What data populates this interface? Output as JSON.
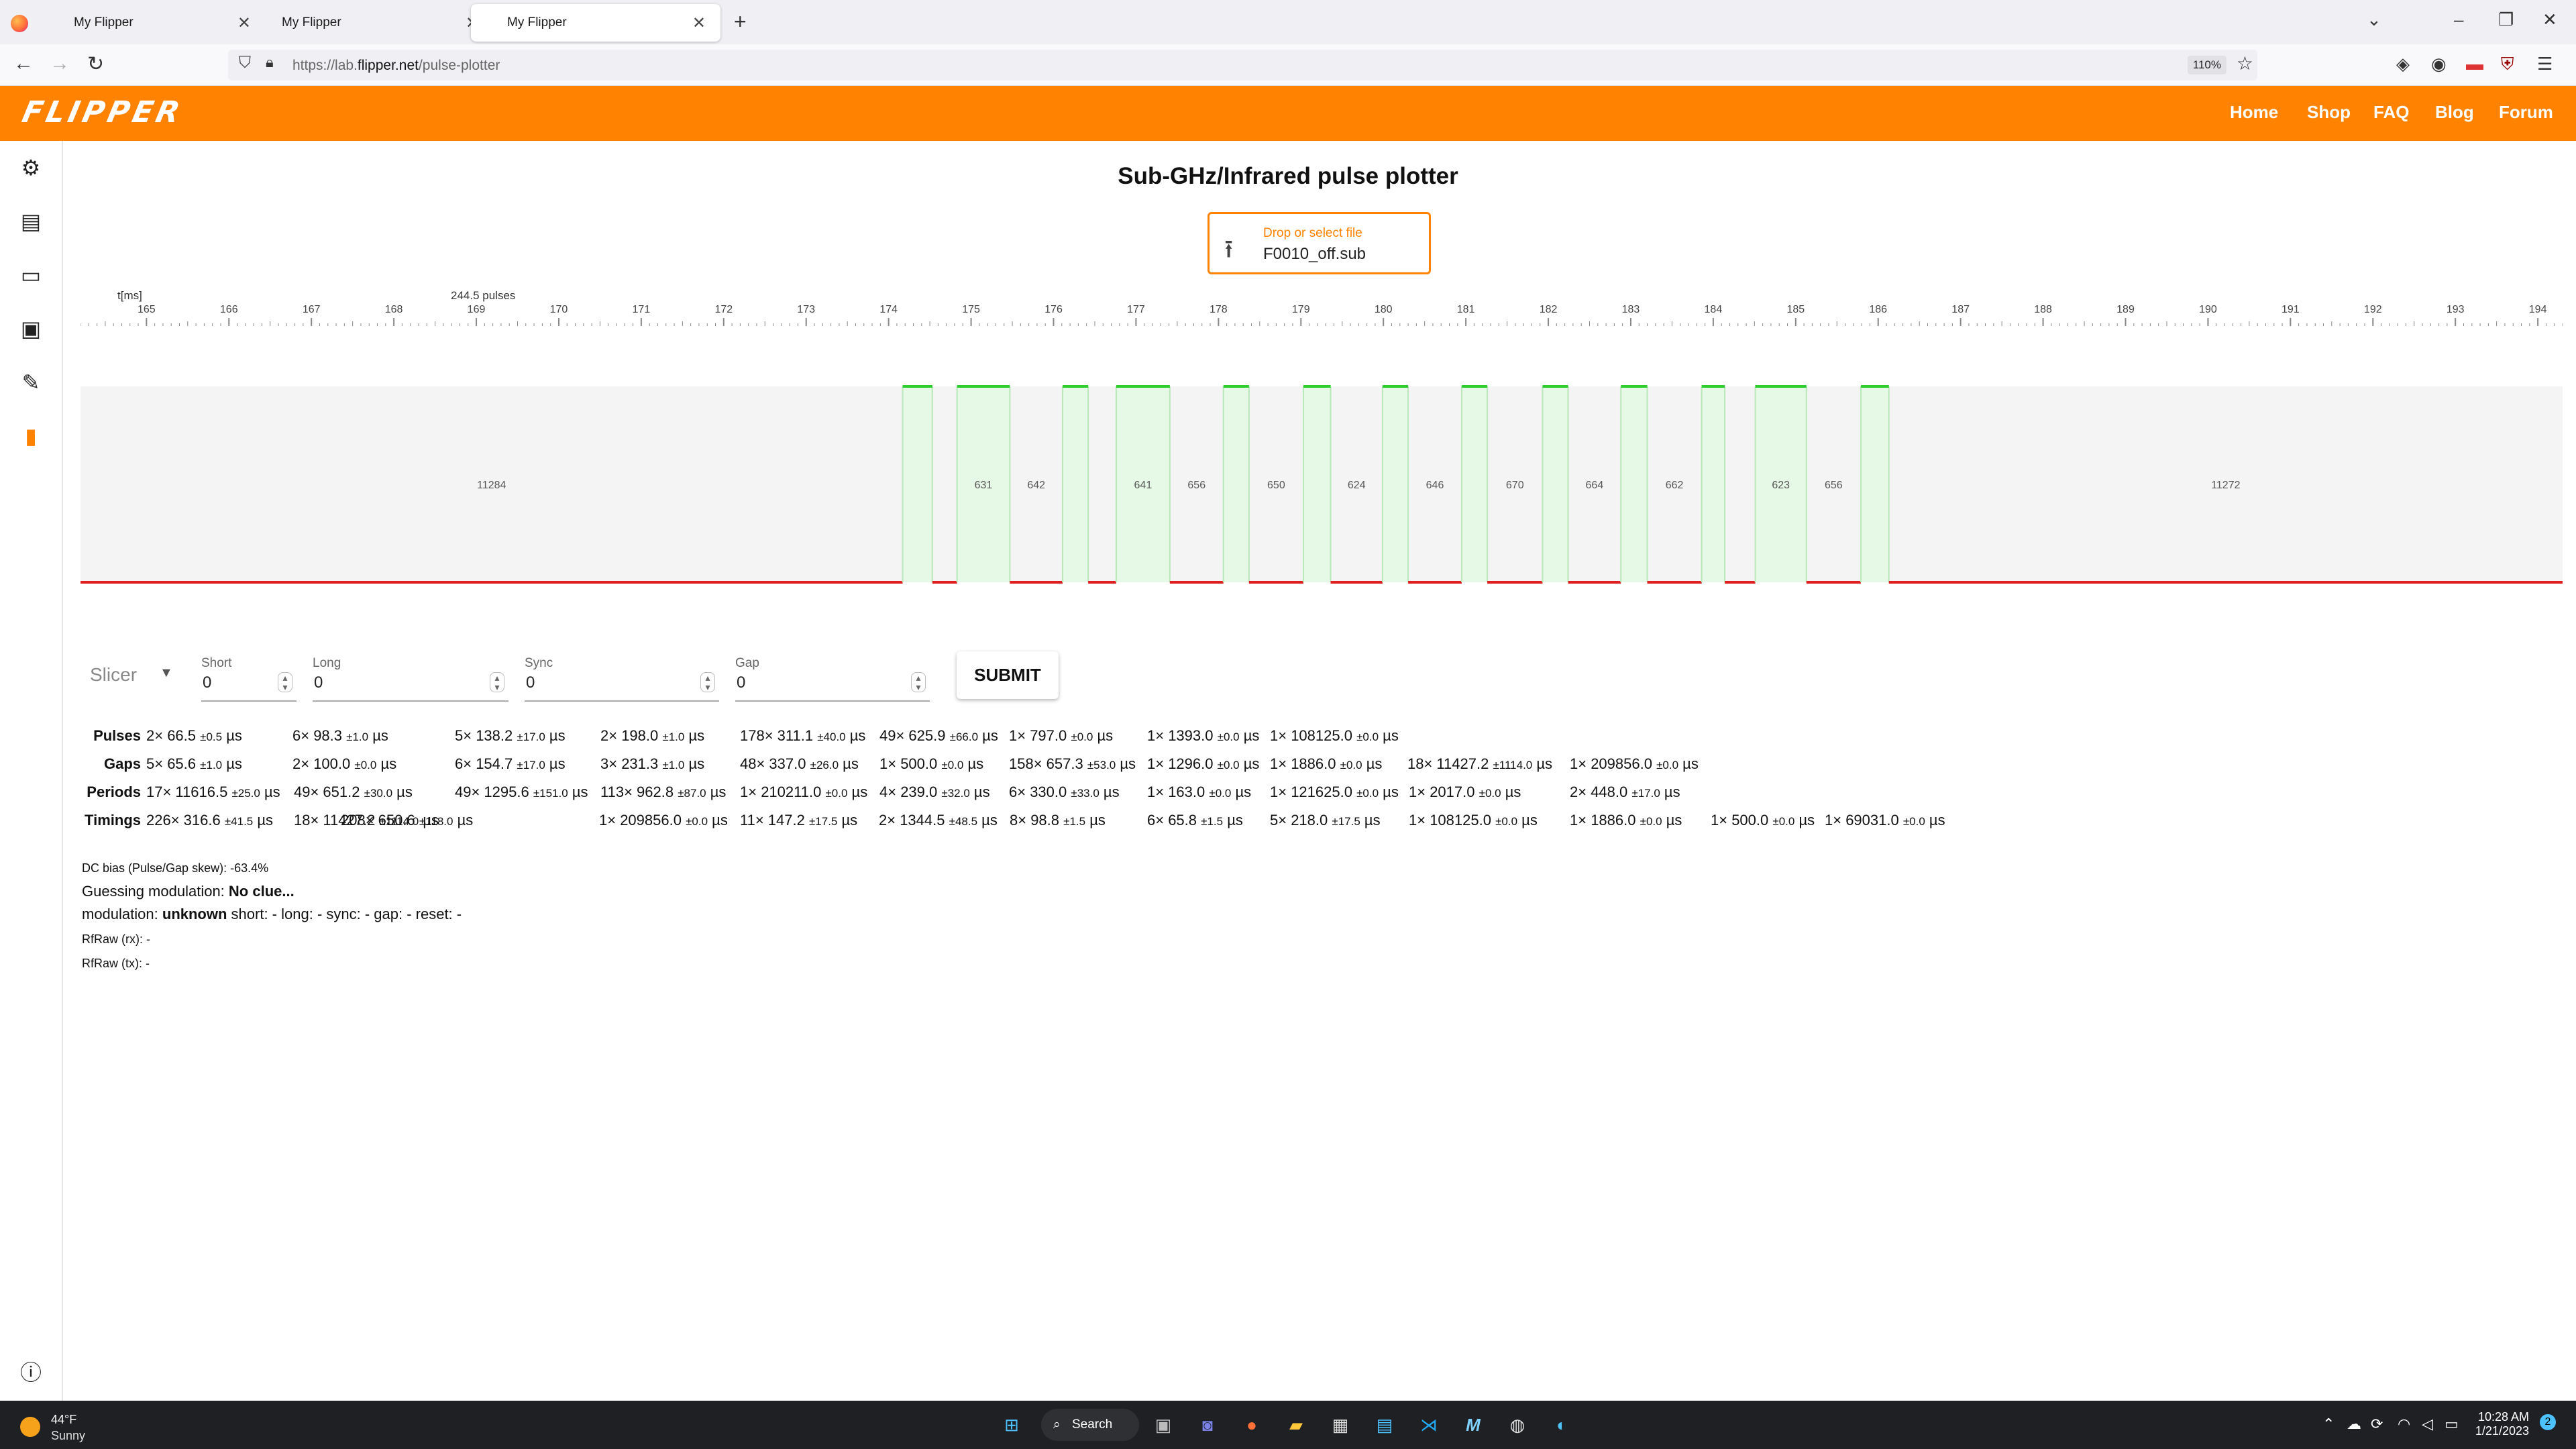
{
  "browser": {
    "tabs": [
      {
        "title": "My Flipper"
      },
      {
        "title": "My Flipper"
      },
      {
        "title": "My Flipper",
        "active": true
      }
    ],
    "url_prefix": "https://lab.",
    "url_domain": "flipper.net",
    "url_path": "/pulse-plotter",
    "zoom": "110%"
  },
  "app": {
    "logo": "FLIPPER",
    "nav": [
      "Home",
      "Shop",
      "FAQ",
      "Blog",
      "Forum"
    ],
    "brand_color": "#ff8200",
    "sidebar_icons": [
      "chip-icon",
      "archive-icon",
      "terminal-icon",
      "device-icon",
      "paint-icon",
      "bar-chart-icon"
    ]
  },
  "page": {
    "title": "Sub-GHz/Infrared pulse plotter",
    "upload_hint": "Drop or select file",
    "file_name": "F0010_off.sub"
  },
  "chart_data": {
    "type": "pulse-timeline",
    "axis_label": "t[ms]",
    "pulse_count_label": "244.5 pulses",
    "x_ticks": [
      165,
      166,
      167,
      168,
      169,
      170,
      171,
      172,
      173,
      174,
      175,
      176,
      177,
      178,
      179,
      180,
      181,
      182,
      183,
      184,
      185,
      186,
      187,
      188,
      189,
      190,
      191,
      192,
      193,
      194
    ],
    "x_range": [
      164.2,
      194.3
    ],
    "segments": [
      {
        "level": 0,
        "start": 164.2,
        "end": 174.17,
        "label": "11284"
      },
      {
        "level": 1,
        "start": 174.17,
        "end": 174.53,
        "label": ""
      },
      {
        "level": 0,
        "start": 174.53,
        "end": 174.83,
        "label": ""
      },
      {
        "level": 1,
        "start": 174.83,
        "end": 175.47,
        "label": "631"
      },
      {
        "level": 0,
        "start": 175.47,
        "end": 176.11,
        "label": "642"
      },
      {
        "level": 1,
        "start": 176.11,
        "end": 176.42,
        "label": ""
      },
      {
        "level": 0,
        "start": 176.42,
        "end": 176.76,
        "label": ""
      },
      {
        "level": 1,
        "start": 176.76,
        "end": 177.41,
        "label": "641"
      },
      {
        "level": 0,
        "start": 177.41,
        "end": 178.06,
        "label": "656"
      },
      {
        "level": 1,
        "start": 178.06,
        "end": 178.37,
        "label": ""
      },
      {
        "level": 0,
        "start": 178.37,
        "end": 179.03,
        "label": "650"
      },
      {
        "level": 1,
        "start": 179.03,
        "end": 179.36,
        "label": ""
      },
      {
        "level": 0,
        "start": 179.36,
        "end": 179.99,
        "label": "624"
      },
      {
        "level": 1,
        "start": 179.99,
        "end": 180.3,
        "label": ""
      },
      {
        "level": 0,
        "start": 180.3,
        "end": 180.95,
        "label": "646"
      },
      {
        "level": 1,
        "start": 180.95,
        "end": 181.26,
        "label": ""
      },
      {
        "level": 0,
        "start": 181.26,
        "end": 181.93,
        "label": "670"
      },
      {
        "level": 1,
        "start": 181.93,
        "end": 182.24,
        "label": ""
      },
      {
        "level": 0,
        "start": 182.24,
        "end": 182.88,
        "label": "664"
      },
      {
        "level": 1,
        "start": 182.88,
        "end": 183.2,
        "label": ""
      },
      {
        "level": 0,
        "start": 183.2,
        "end": 183.86,
        "label": "662"
      },
      {
        "level": 1,
        "start": 183.86,
        "end": 184.14,
        "label": ""
      },
      {
        "level": 0,
        "start": 184.14,
        "end": 184.51,
        "label": ""
      },
      {
        "level": 1,
        "start": 184.51,
        "end": 185.13,
        "label": "623"
      },
      {
        "level": 0,
        "start": 185.13,
        "end": 185.79,
        "label": "656"
      },
      {
        "level": 1,
        "start": 185.79,
        "end": 186.13,
        "label": ""
      },
      {
        "level": 0,
        "start": 186.13,
        "end": 194.3,
        "label": "11272"
      }
    ],
    "colors": {
      "high_fill": "#e6f8e6",
      "high_line": "#2ecc2e",
      "low_line": "#e02020",
      "bg": "#f4f4f4"
    }
  },
  "form": {
    "slicer": "Slicer",
    "fields": [
      {
        "label": "Short",
        "value": "0"
      },
      {
        "label": "Long",
        "value": "0"
      },
      {
        "label": "Sync",
        "value": "0"
      },
      {
        "label": "Gap",
        "value": "0"
      }
    ],
    "submit": "SUBMIT"
  },
  "stats": [
    {
      "label": "Pulses",
      "cells": [
        {
          "main": "2× 66.5",
          "dev": "±0.5",
          "unit": "µs"
        },
        {
          "main": "6× 98.3",
          "dev": "±1.0",
          "unit": "µs"
        },
        {
          "main": "5× 138.2",
          "dev": "±17.0",
          "unit": "µs"
        },
        {
          "main": "2× 198.0",
          "dev": "±1.0",
          "unit": "µs"
        },
        {
          "main": "178× 311.1",
          "dev": "±40.0",
          "unit": "µs"
        },
        {
          "main": "49× 625.9",
          "dev": "±66.0",
          "unit": "µs"
        },
        {
          "main": "1× 797.0",
          "dev": "±0.0",
          "unit": "µs"
        },
        {
          "main": "1× 1393.0",
          "dev": "±0.0",
          "unit": "µs"
        },
        {
          "main": "1× 108125.0",
          "dev": "±0.0",
          "unit": "µs"
        }
      ]
    },
    {
      "label": "Gaps",
      "cells": [
        {
          "main": "5× 65.6",
          "dev": "±1.0",
          "unit": "µs"
        },
        {
          "main": "2× 100.0",
          "dev": "±0.0",
          "unit": "µs"
        },
        {
          "main": "6× 154.7",
          "dev": "±17.0",
          "unit": "µs"
        },
        {
          "main": "3× 231.3",
          "dev": "±1.0",
          "unit": "µs"
        },
        {
          "main": "48× 337.0",
          "dev": "±26.0",
          "unit": "µs"
        },
        {
          "main": "1× 500.0",
          "dev": "±0.0",
          "unit": "µs"
        },
        {
          "main": "158× 657.3",
          "dev": "±53.0",
          "unit": "µs"
        },
        {
          "main": "1× 1296.0",
          "dev": "±0.0",
          "unit": "µs"
        },
        {
          "main": "1× 1886.0",
          "dev": "±0.0",
          "unit": "µs"
        },
        {
          "main": "18× 11427.2",
          "dev": "±1114.0",
          "unit": "µs"
        },
        {
          "main": "1× 209856.0",
          "dev": "±0.0",
          "unit": "µs"
        }
      ]
    },
    {
      "label": "Periods",
      "cells": [
        {
          "main": "17× 11616.5",
          "dev": "±25.0",
          "unit": "µs"
        },
        {
          "main": "49× 651.2",
          "dev": "±30.0",
          "unit": "µs"
        },
        {
          "main": "49× 1295.6",
          "dev": "±151.0",
          "unit": "µs"
        },
        {
          "main": "113× 962.8",
          "dev": "±87.0",
          "unit": "µs"
        },
        {
          "main": "1× 210211.0",
          "dev": "±0.0",
          "unit": "µs"
        },
        {
          "main": "4× 239.0",
          "dev": "±32.0",
          "unit": "µs"
        },
        {
          "main": "6× 330.0",
          "dev": "±33.0",
          "unit": "µs"
        },
        {
          "main": "1× 163.0",
          "dev": "±0.0",
          "unit": "µs"
        },
        {
          "main": "1× 121625.0",
          "dev": "±0.0",
          "unit": "µs"
        },
        {
          "main": "1× 2017.0",
          "dev": "±0.0",
          "unit": "µs"
        },
        {
          "main": "2× 448.0",
          "dev": "±17.0",
          "unit": "µs"
        }
      ]
    },
    {
      "label": "Timings",
      "cells": [
        {
          "main": "226× 316.6",
          "dev": "±41.5",
          "unit": "µs"
        },
        {
          "main": "18× 11427.2",
          "dev": "±1114.0",
          "unit": "µs"
        },
        {
          "main": "208× 650.6",
          "dev": "±118.0",
          "unit": "µs"
        },
        {
          "main": "1× 209856.0",
          "dev": "±0.0",
          "unit": "µs"
        },
        {
          "main": "11× 147.2",
          "dev": "±17.5",
          "unit": "µs"
        },
        {
          "main": "2× 1344.5",
          "dev": "±48.5",
          "unit": "µs"
        },
        {
          "main": "8× 98.8",
          "dev": "±1.5",
          "unit": "µs"
        },
        {
          "main": "6× 65.8",
          "dev": "±1.5",
          "unit": "µs"
        },
        {
          "main": "5× 218.0",
          "dev": "±17.5",
          "unit": "µs"
        },
        {
          "main": "1× 108125.0",
          "dev": "±0.0",
          "unit": "µs"
        },
        {
          "main": "1× 1886.0",
          "dev": "±0.0",
          "unit": "µs"
        },
        {
          "main": "1× 500.0",
          "dev": "±0.0",
          "unit": "µs"
        },
        {
          "main": "1× 69031.0",
          "dev": "±0.0",
          "unit": "µs"
        }
      ]
    }
  ],
  "info": {
    "dc_bias": "DC bias (Pulse/Gap skew): -63.4%",
    "guess_label": "Guessing modulation:",
    "guess_value": "No clue...",
    "mod_label": "modulation:",
    "mod_value": "unknown",
    "mod_rest": "short: - long: - sync: - gap: - reset: -",
    "rfraw_rx": "RfRaw (rx): -",
    "rfraw_tx": "RfRaw (tx): -"
  },
  "taskbar": {
    "temp": "44°F",
    "weather": "Sunny",
    "search": "Search",
    "time": "10:28 AM",
    "date": "1/21/2023",
    "notif": "2"
  }
}
